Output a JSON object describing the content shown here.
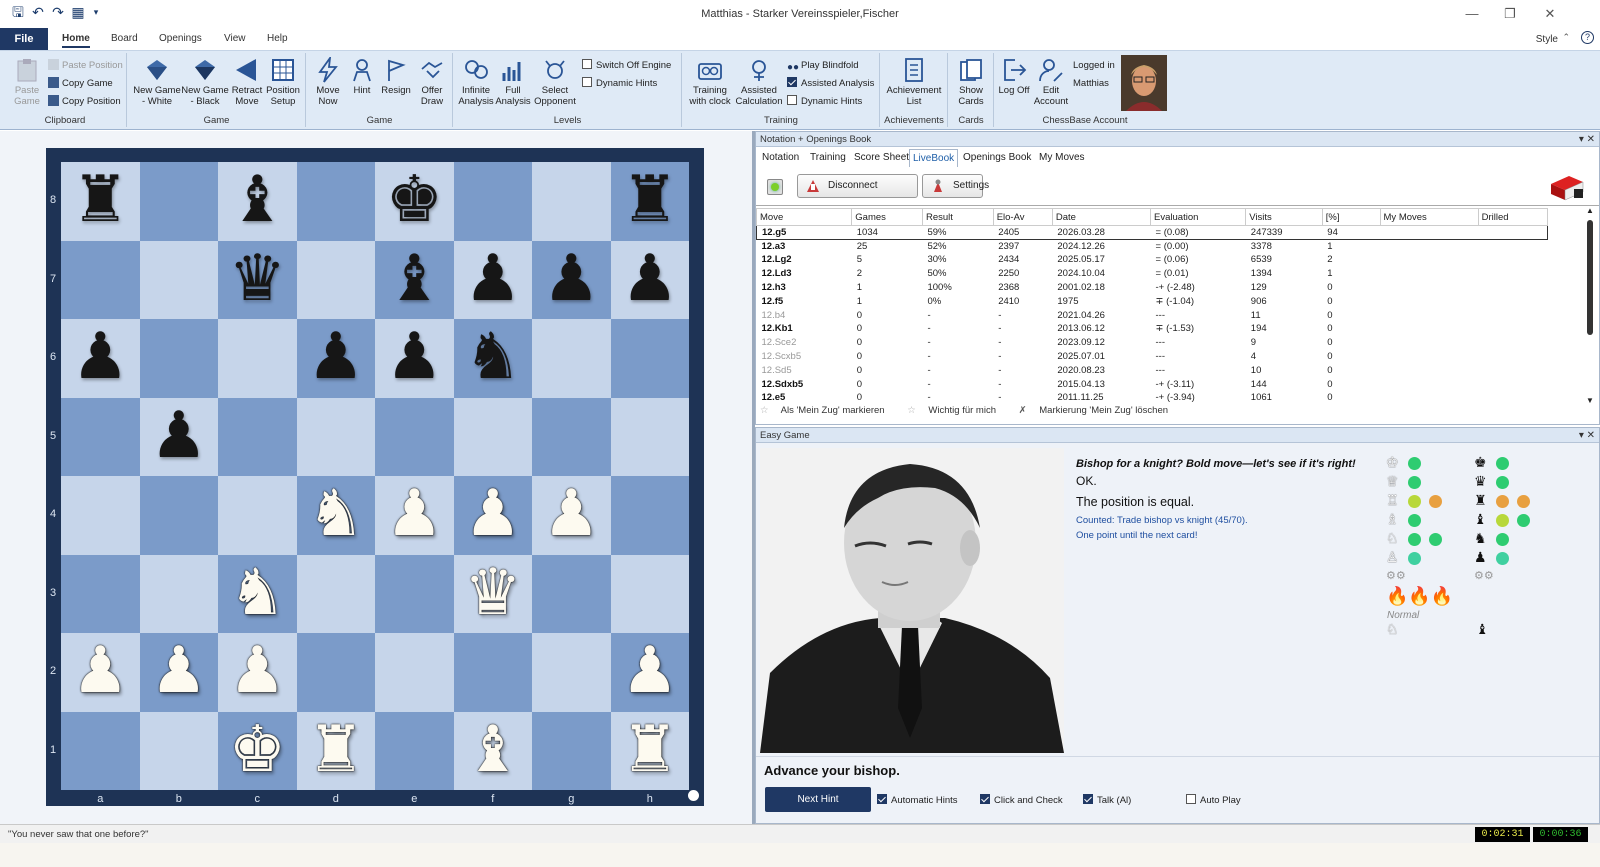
{
  "window": {
    "title": "Matthias - Starker Vereinsspieler,Fischer",
    "style_label": "Style"
  },
  "menu": {
    "file": "File",
    "tabs": [
      "Home",
      "Board",
      "Openings",
      "View",
      "Help"
    ]
  },
  "ribbon": {
    "clipboard": {
      "label": "Clipboard",
      "paste_game": "Paste Game",
      "paste_position": "Paste Position",
      "copy_game": "Copy Game",
      "copy_position": "Copy Position"
    },
    "game": {
      "label": "Game",
      "new_white": "New Game - White",
      "new_black": "New Game - Black",
      "retract": "Retract Move",
      "position_setup": "Position Setup"
    },
    "game2": {
      "label": "Game",
      "move_now": "Move Now",
      "hint": "Hint",
      "resign": "Resign",
      "offer_draw": "Offer Draw"
    },
    "levels": {
      "label": "Levels",
      "infinite": "Infinite Analysis",
      "full": "Full Analysis",
      "select_opponent": "Select Opponent",
      "switch_off_engine": "Switch Off Engine",
      "dynamic_hints": "Dynamic Hints"
    },
    "training": {
      "label": "Training",
      "with_clock": "Training with clock",
      "assisted_calc": "Assisted Calculation",
      "play_blindfold": "Play Blindfold",
      "assisted_analysis": "Assisted Analysis",
      "dynamic_hints": "Dynamic Hints"
    },
    "achievements": {
      "label": "Achievements",
      "list": "Achievement List"
    },
    "cards": {
      "label": "Cards",
      "show": "Show Cards"
    },
    "account": {
      "label": "ChessBase Account",
      "log_off": "Log Off",
      "edit": "Edit Account",
      "logged_in": "Logged in",
      "user": "Matthias"
    }
  },
  "board": {
    "files": [
      "a",
      "b",
      "c",
      "d",
      "e",
      "f",
      "g",
      "h"
    ],
    "ranks": [
      "8",
      "7",
      "6",
      "5",
      "4",
      "3",
      "2",
      "1"
    ],
    "position": [
      "r.b.k..r",
      "..q.bppp",
      "p..ppn..",
      ".p......",
      "...NPPP.",
      "..N..Q..",
      "PPP....P",
      "..KR.B.R"
    ]
  },
  "notation": {
    "header": "Notation + Openings Book",
    "tabs": [
      "Notation",
      "Training",
      "Score Sheet",
      "LiveBook",
      "Openings Book",
      "My Moves"
    ],
    "active_tab": "LiveBook",
    "disconnect": "Disconnect",
    "settings": "Settings",
    "columns": [
      "Move",
      "Games",
      "Result",
      "Elo-Av",
      "Date",
      "Evaluation",
      "Visits",
      "[%]",
      "My Moves",
      "Drilled"
    ],
    "rows": [
      {
        "move": "12.g5",
        "games": "1034",
        "result": "59%",
        "elo": "2405",
        "date": "2026.03.28",
        "eval": "= (0.08)",
        "visits": "247339",
        "pct": "94",
        "style": "b"
      },
      {
        "move": "12.a3",
        "games": "25",
        "result": "52%",
        "elo": "2397",
        "date": "2024.12.26",
        "eval": "= (0.00)",
        "visits": "3378",
        "pct": "1",
        "style": "b"
      },
      {
        "move": "12.Lg2",
        "games": "5",
        "result": "30%",
        "elo": "2434",
        "date": "2025.05.17",
        "eval": "= (0.06)",
        "visits": "6539",
        "pct": "2",
        "style": "b"
      },
      {
        "move": "12.Ld3",
        "games": "2",
        "result": "50%",
        "elo": "2250",
        "date": "2024.10.04",
        "eval": "= (0.01)",
        "visits": "1394",
        "pct": "1",
        "style": "b"
      },
      {
        "move": "12.h3",
        "games": "1",
        "result": "100%",
        "elo": "2368",
        "date": "2001.02.18",
        "eval": "-+ (-2.48)",
        "visits": "129",
        "pct": "0",
        "style": "b"
      },
      {
        "move": "12.f5",
        "games": "1",
        "result": "0%",
        "elo": "2410",
        "date": "1975",
        "eval": "∓ (-1.04)",
        "visits": "906",
        "pct": "0",
        "style": "b"
      },
      {
        "move": "12.b4",
        "games": "0",
        "result": "-",
        "elo": "-",
        "date": "2021.04.26",
        "eval": "---",
        "visits": "11",
        "pct": "0",
        "style": "g"
      },
      {
        "move": "12.Kb1",
        "games": "0",
        "result": "-",
        "elo": "-",
        "date": "2013.06.12",
        "eval": "∓ (-1.53)",
        "visits": "194",
        "pct": "0",
        "style": "b"
      },
      {
        "move": "12.Sce2",
        "games": "0",
        "result": "-",
        "elo": "-",
        "date": "2023.09.12",
        "eval": "---",
        "visits": "9",
        "pct": "0",
        "style": "g"
      },
      {
        "move": "12.Scxb5",
        "games": "0",
        "result": "-",
        "elo": "-",
        "date": "2025.07.01",
        "eval": "---",
        "visits": "4",
        "pct": "0",
        "style": "g"
      },
      {
        "move": "12.Sd5",
        "games": "0",
        "result": "-",
        "elo": "-",
        "date": "2020.08.23",
        "eval": "---",
        "visits": "10",
        "pct": "0",
        "style": "g"
      },
      {
        "move": "12.Sdxb5",
        "games": "0",
        "result": "-",
        "elo": "-",
        "date": "2015.04.13",
        "eval": "-+ (-3.11)",
        "visits": "144",
        "pct": "0",
        "style": "b"
      },
      {
        "move": "12.e5",
        "games": "0",
        "result": "-",
        "elo": "-",
        "date": "2011.11.25",
        "eval": "-+ (-3.94)",
        "visits": "1061",
        "pct": "0",
        "style": "b"
      }
    ],
    "footer": [
      "Als 'Mein Zug' markieren",
      "Wichtig für mich",
      "Markierung 'Mein Zug' löschen"
    ]
  },
  "easy": {
    "header": "Easy Game",
    "line1": "Bishop for a knight? Bold move—let's see if it's right!",
    "line2": "OK.",
    "line3": "The position is equal.",
    "line4": "Counted: Trade bishop vs knight (45/70).",
    "line5": "One point until the next card!",
    "normal": "Normal",
    "hint_text": "Advance your bishop.",
    "next_hint": "Next Hint",
    "auto_hints": "Automatic Hints",
    "click_check": "Click and Check",
    "talk": "Talk (Al)",
    "auto_play": "Auto Play",
    "colors": {
      "green": "#2ecc71",
      "teal": "#3fd0a0",
      "yellow": "#b8d83a",
      "orange": "#e8a040"
    }
  },
  "status": {
    "text": "\"You never saw that one before?\"",
    "clock_white": "0:02:31",
    "clock_black": "0:00:36"
  }
}
